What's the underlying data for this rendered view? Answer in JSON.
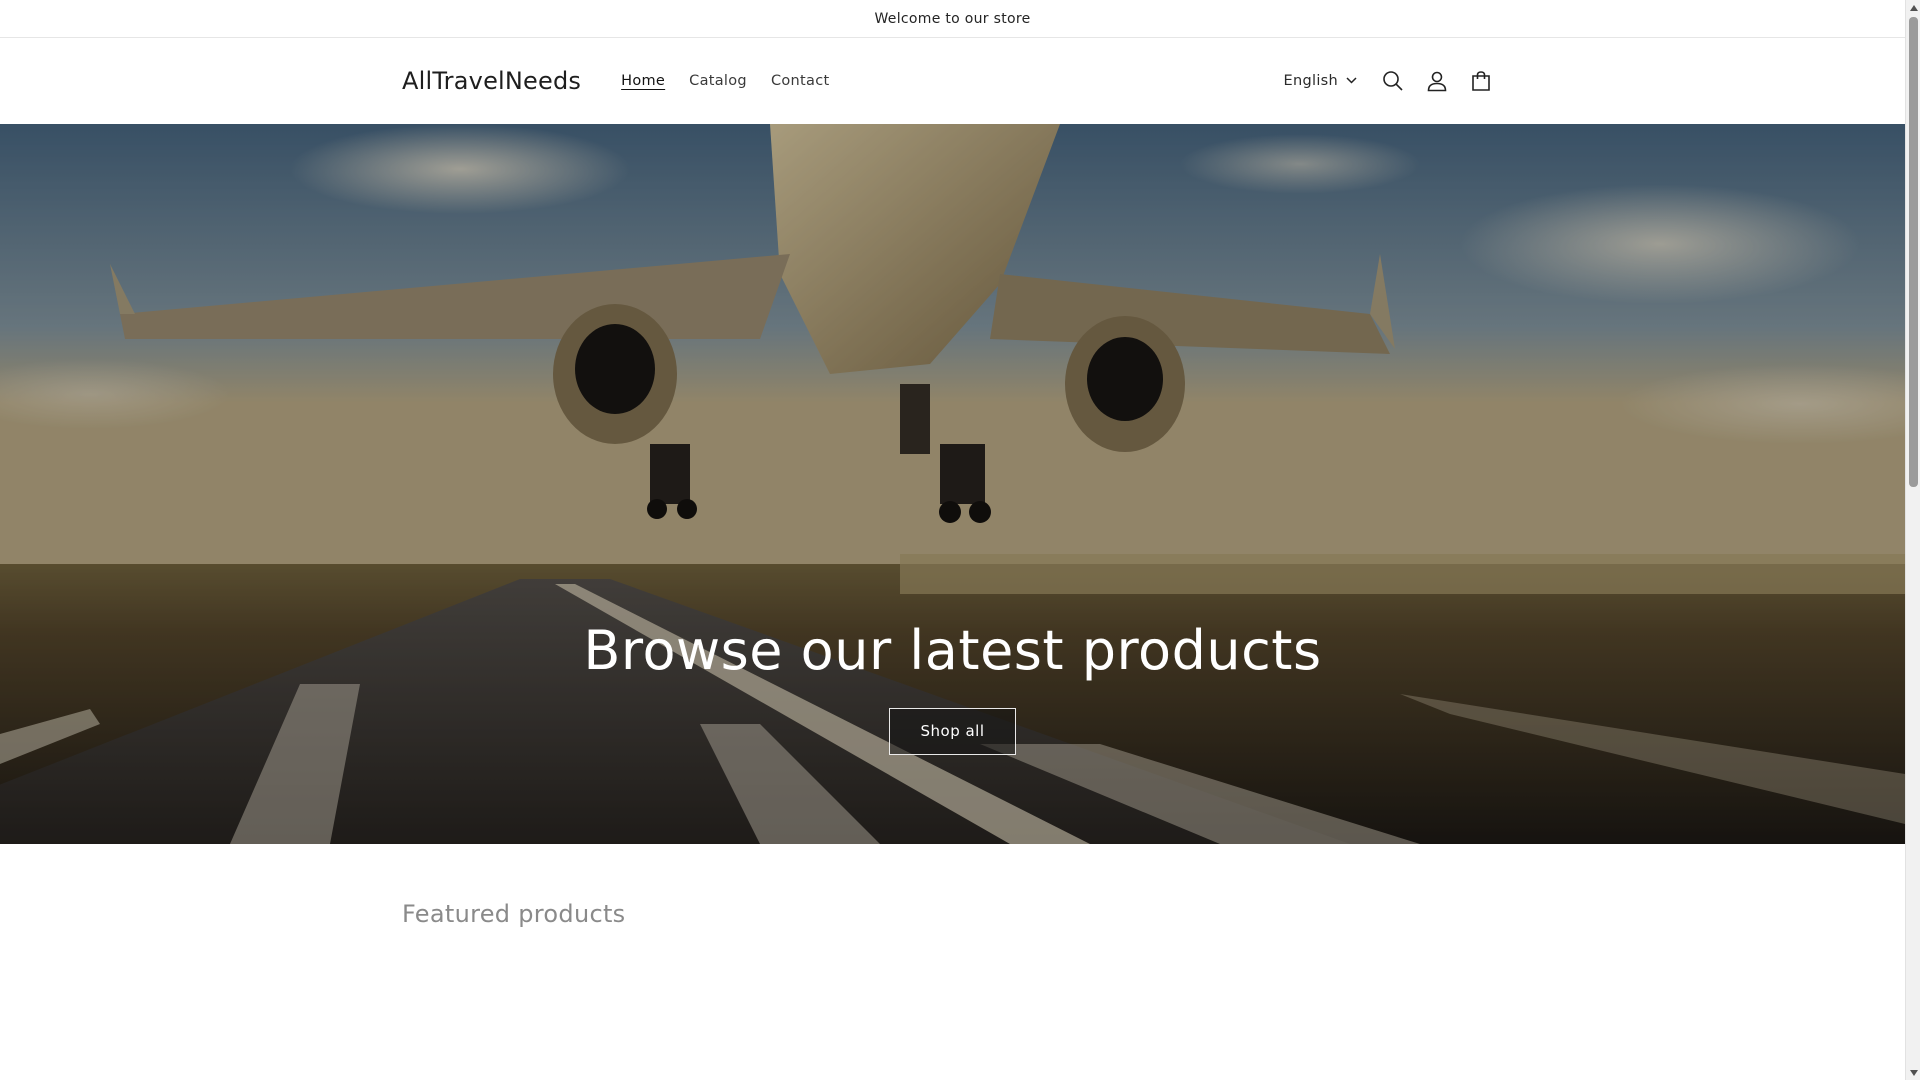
{
  "announcement": {
    "text": "Welcome to our store"
  },
  "header": {
    "logo": "AllTravelNeeds",
    "nav": [
      {
        "label": "Home",
        "active": true
      },
      {
        "label": "Catalog",
        "active": false
      },
      {
        "label": "Contact",
        "active": false
      }
    ],
    "language": "English",
    "icons": [
      "search-icon",
      "account-icon",
      "cart-icon"
    ]
  },
  "hero": {
    "title": "Browse our latest products",
    "button_label": "Shop all",
    "image": "airplane-takeoff-runway"
  },
  "featured": {
    "title": "Featured products"
  },
  "colors": {
    "text": "#121212",
    "border": "#e6e6e6",
    "hero_button_bg": "#1c1c1c"
  }
}
